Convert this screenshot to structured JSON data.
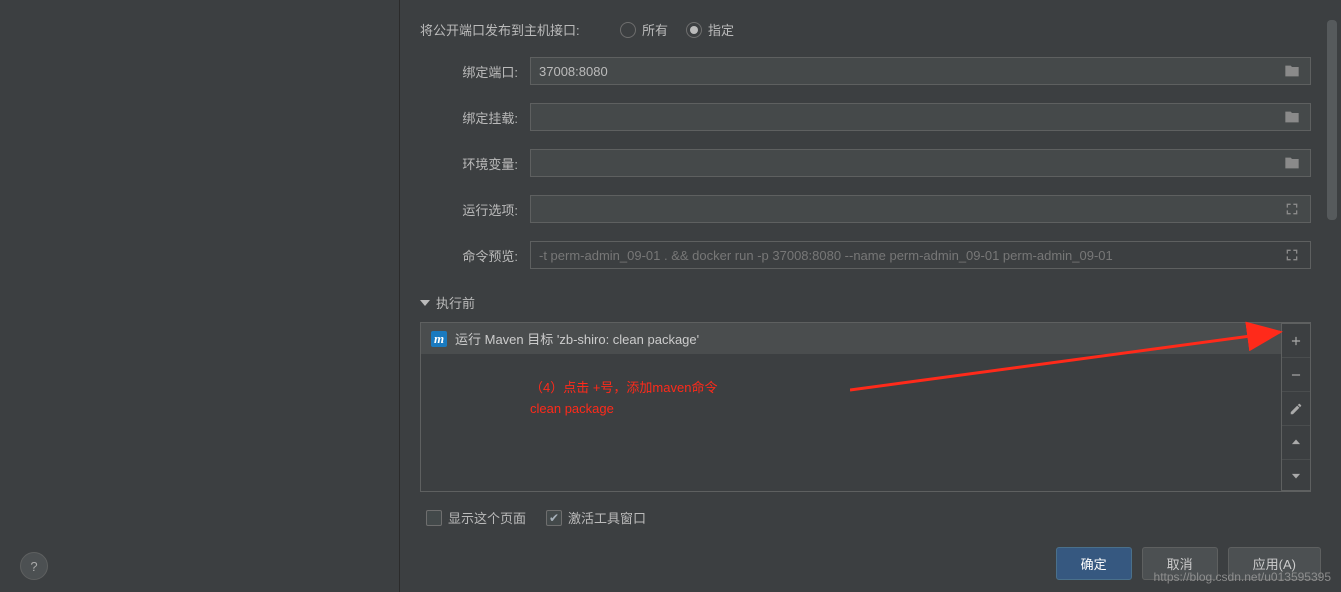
{
  "publish": {
    "label": "将公开端口发布到主机接口:",
    "option_all": "所有",
    "option_specified": "指定",
    "selected": "指定"
  },
  "fields": {
    "bind_port": {
      "label": "绑定端口:",
      "value": "37008:8080"
    },
    "bind_mount": {
      "label": "绑定挂载:",
      "value": ""
    },
    "env_vars": {
      "label": "环境变量:",
      "value": ""
    },
    "run_opts": {
      "label": "运行选项:",
      "value": ""
    },
    "cmd_preview": {
      "label": "命令预览:",
      "value": "-t perm-admin_09-01 . && docker run -p 37008:8080 --name perm-admin_09-01 perm-admin_09-01"
    }
  },
  "before": {
    "title": "执行前",
    "item": "运行 Maven 目标 'zb-shiro: clean package'"
  },
  "checks": {
    "show_page": "显示这个页面",
    "activate_tool": "激活工具窗口",
    "show_page_checked": false,
    "activate_tool_checked": true
  },
  "buttons": {
    "ok": "确定",
    "cancel": "取消",
    "apply": "应用(A)"
  },
  "annotation": {
    "line1": "（4）点击 +号，添加maven命令",
    "line2": "clean package"
  },
  "watermark": "https://blog.csdn.net/u013595395"
}
